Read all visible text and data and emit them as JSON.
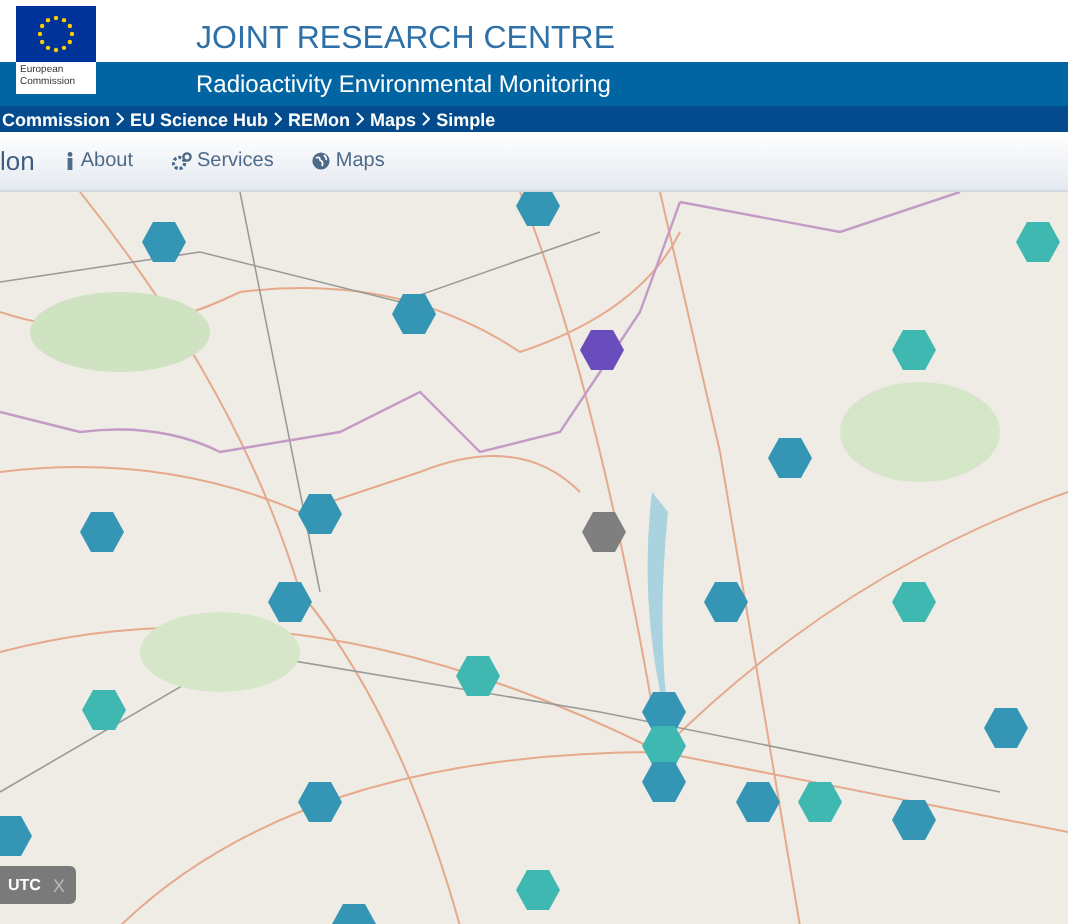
{
  "header": {
    "logo_caption": "European Commission",
    "title": "JOINT RESEARCH CENTRE",
    "subtitle": "Radioactivity Environmental Monitoring"
  },
  "breadcrumb": [
    "Commission",
    "EU Science Hub",
    "REMon",
    "Maps",
    "Simple"
  ],
  "nav": {
    "brand": "lon",
    "items": [
      {
        "kind": "info",
        "label": "About"
      },
      {
        "kind": "cogs",
        "label": "Services"
      },
      {
        "kind": "globe",
        "label": "Maps"
      }
    ]
  },
  "markers": [
    {
      "color": "#3595b4"
    },
    {
      "color": "#3595b4"
    },
    {
      "color": "#40b8b2"
    },
    {
      "color": "#3595b4"
    },
    {
      "color": "#6a4dbd"
    },
    {
      "color": "#40b8b2"
    },
    {
      "color": "#3595b4"
    },
    {
      "color": "#3595b4"
    },
    {
      "color": "#3595b4"
    },
    {
      "color": "#7f7f7f"
    },
    {
      "color": "#3595b4"
    },
    {
      "color": "#3595b4"
    },
    {
      "color": "#40b8b2"
    },
    {
      "color": "#40b8b2"
    },
    {
      "color": "#40b8b2"
    },
    {
      "color": "#3595b4"
    },
    {
      "color": "#40b8b2"
    },
    {
      "color": "#3595b4"
    },
    {
      "color": "#3595b4"
    },
    {
      "color": "#3595b4"
    },
    {
      "color": "#3595b4"
    },
    {
      "color": "#40b8b2"
    },
    {
      "color": "#3595b4"
    },
    {
      "color": "#3595b4"
    },
    {
      "color": "#40b8b2"
    },
    {
      "color": "#3595b4"
    }
  ],
  "time_control": {
    "label": "UTC",
    "close": "X"
  }
}
